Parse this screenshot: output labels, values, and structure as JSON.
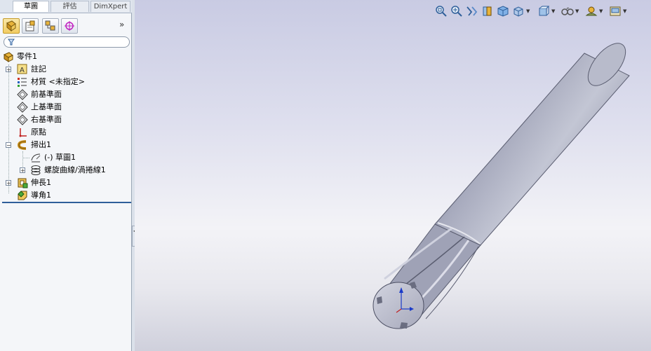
{
  "tabs": {
    "items": [
      {
        "label": "草圖",
        "active": true
      },
      {
        "label": "評估",
        "active": false
      },
      {
        "label": "DimXpert",
        "active": false
      }
    ]
  },
  "panel_tabs": {
    "items": [
      {
        "icon": "feature-manager-icon",
        "active": true
      },
      {
        "icon": "property-manager-icon",
        "active": false
      },
      {
        "icon": "configuration-manager-icon",
        "active": false
      },
      {
        "icon": "dimxpert-manager-icon",
        "active": false
      }
    ],
    "expand_glyph": "»"
  },
  "filter": {
    "icon": "filter-icon",
    "value": ""
  },
  "tree": {
    "root": {
      "label": "零件1",
      "icon": "part-icon"
    },
    "items": [
      {
        "label": "註記",
        "icon": "annotations-icon",
        "expandable": true
      },
      {
        "label": "材質 <未指定>",
        "icon": "material-icon",
        "expandable": false
      },
      {
        "label": "前基準面",
        "icon": "plane-icon",
        "expandable": false
      },
      {
        "label": "上基準面",
        "icon": "plane-icon",
        "expandable": false
      },
      {
        "label": "右基準面",
        "icon": "plane-icon",
        "expandable": false
      },
      {
        "label": "原點",
        "icon": "origin-icon",
        "expandable": false
      },
      {
        "label": "掃出1",
        "icon": "sweep-icon",
        "expandable": true,
        "expanded": true
      },
      {
        "label": "(-) 草圖1",
        "icon": "sketch-icon",
        "expandable": false,
        "child": true
      },
      {
        "label": "螺旋曲線/渦捲線1",
        "icon": "helix-icon",
        "expandable": true,
        "child": true
      },
      {
        "label": "伸長1",
        "icon": "extrude-icon",
        "expandable": true
      },
      {
        "label": "導角1",
        "icon": "chamfer-icon",
        "expandable": false
      }
    ]
  },
  "splitter": {
    "glyph": "◂"
  },
  "view_toolbar": {
    "items": [
      {
        "icon": "zoom-to-fit-icon"
      },
      {
        "icon": "zoom-to-area-icon"
      },
      {
        "icon": "previous-view-icon"
      },
      {
        "icon": "section-view-icon"
      },
      {
        "icon": "view-orientation-icon"
      },
      {
        "icon": "display-style-icon",
        "dropdown": true
      },
      {
        "icon": "hide-show-items-icon",
        "dropdown": true
      },
      {
        "icon": "edit-appearance-icon",
        "dropdown": true
      },
      {
        "icon": "apply-scene-icon",
        "dropdown": true
      },
      {
        "icon": "view-settings-icon",
        "dropdown": true
      }
    ]
  },
  "colors": {
    "accent": "#2f5f9a",
    "viewport_top": "#c9cbe3",
    "viewport_bottom": "#cfd0dc",
    "model": "#a9acbf"
  }
}
